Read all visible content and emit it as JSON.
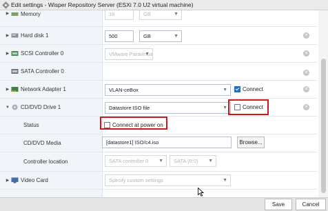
{
  "window": {
    "title": "Edit settings - Wisper Repository Server (ESXi 7.0 U2 virtual machine)"
  },
  "rows": {
    "memory": {
      "label": "Memory",
      "value": "16",
      "unit": "GB"
    },
    "hard_disk": {
      "label": "Hard disk 1",
      "value": "500",
      "unit": "GB"
    },
    "scsi": {
      "label": "SCSI Controller 0",
      "value": "VMware Paravirtual"
    },
    "sata": {
      "label": "SATA Controller 0"
    },
    "network": {
      "label": "Network Adapter 1",
      "value": "VLAN-ceBox",
      "connect_label": "Connect",
      "connected": true
    },
    "cddvd": {
      "label": "CD/DVD Drive 1",
      "value": "Datastore ISO file",
      "connect_label": "Connect",
      "connected": false
    },
    "status": {
      "label": "Status",
      "checkbox_label": "Connect at power on",
      "checked": false
    },
    "media": {
      "label": "CD/DVD Media",
      "value": "[datastore1] ISO/c4.iso",
      "browse_label": "Browse..."
    },
    "controller": {
      "label": "Controller location",
      "controller_value": "SATA controller 0",
      "slot_value": "SATA (0:0)"
    },
    "video": {
      "label": "Video Card",
      "value": "Specify custom settings"
    }
  },
  "footer": {
    "save_label": "Save",
    "cancel_label": "Cancel"
  },
  "colors": {
    "highlight": "#d01818",
    "label_column": "#f1f5fa",
    "checkbox_checked": "#1a73c8"
  }
}
